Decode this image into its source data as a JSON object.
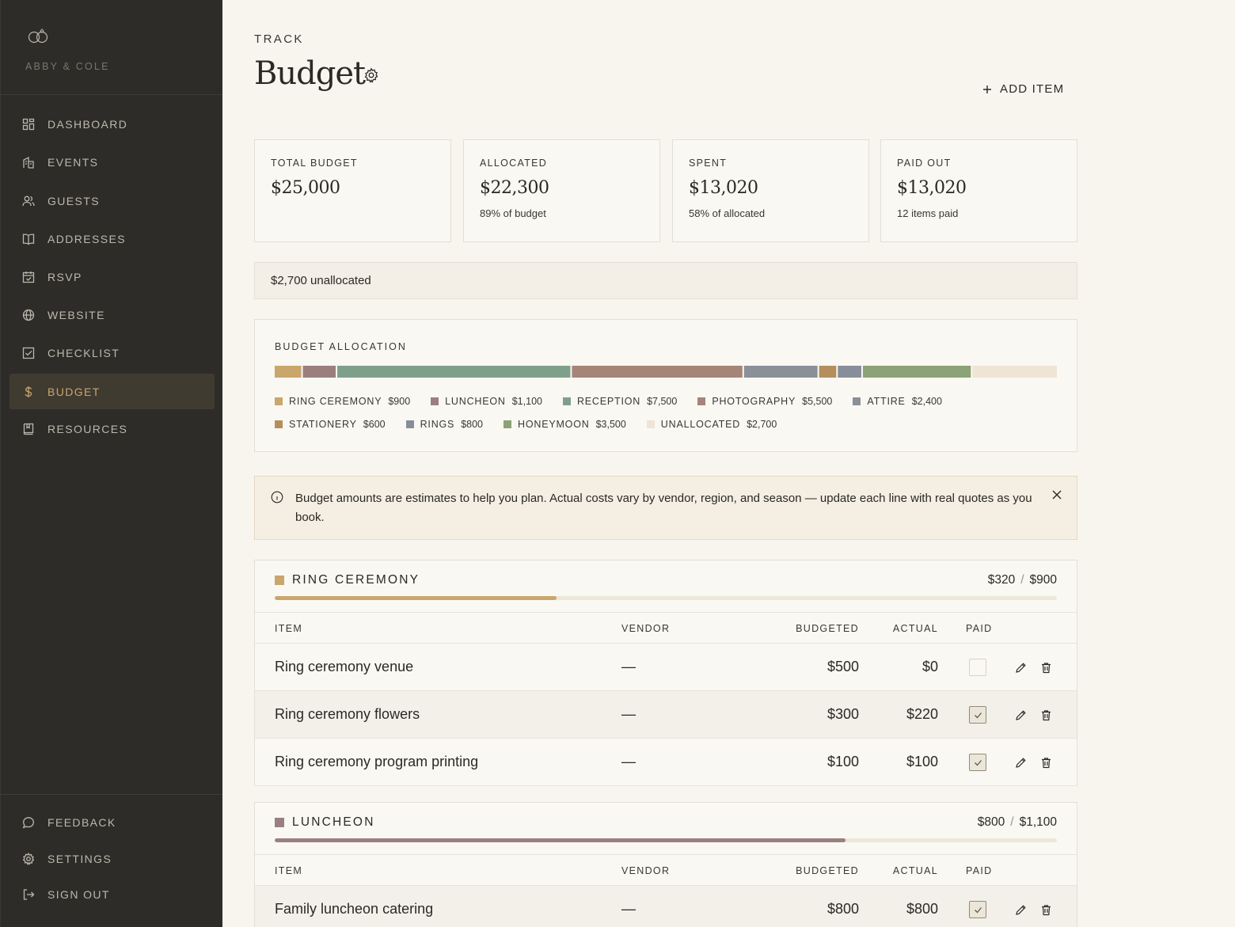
{
  "app": {
    "couple_name": "ABBY & COLE"
  },
  "sidebar": {
    "items": [
      {
        "label": "DASHBOARD",
        "icon": "dashboard-icon"
      },
      {
        "label": "EVENTS",
        "icon": "building-icon"
      },
      {
        "label": "GUESTS",
        "icon": "users-icon"
      },
      {
        "label": "ADDRESSES",
        "icon": "book-icon"
      },
      {
        "label": "RSVP",
        "icon": "calendar-check-icon"
      },
      {
        "label": "WEBSITE",
        "icon": "globe-icon"
      },
      {
        "label": "CHECKLIST",
        "icon": "checkbox-icon"
      },
      {
        "label": "BUDGET",
        "icon": "dollar-icon",
        "active": true
      },
      {
        "label": "RESOURCES",
        "icon": "bookmark-book-icon"
      }
    ],
    "footer": [
      {
        "label": "FEEDBACK",
        "icon": "chat-bubble-icon"
      },
      {
        "label": "SETTINGS",
        "icon": "gear-icon"
      },
      {
        "label": "SIGN OUT",
        "icon": "sign-out-icon"
      }
    ]
  },
  "header": {
    "eyebrow": "TRACK",
    "title": "Budget",
    "add_label": "ADD ITEM"
  },
  "summary": [
    {
      "label": "TOTAL BUDGET",
      "value": "$25,000",
      "sub": ""
    },
    {
      "label": "ALLOCATED",
      "value": "$22,300",
      "sub": "89% of budget"
    },
    {
      "label": "SPENT",
      "value": "$13,020",
      "sub": "58% of allocated"
    },
    {
      "label": "PAID OUT",
      "value": "$13,020",
      "sub": "12 items paid"
    }
  ],
  "unallocated_text": "$2,700 unallocated",
  "allocation": {
    "label": "BUDGET ALLOCATION",
    "total": 25000,
    "segments": [
      {
        "name": "RING CEREMONY",
        "amount": "$900",
        "value": 900,
        "color": "#c9a66b"
      },
      {
        "name": "LUNCHEON",
        "amount": "$1,100",
        "value": 1100,
        "color": "#9b7f7f"
      },
      {
        "name": "RECEPTION",
        "amount": "$7,500",
        "value": 7500,
        "color": "#7ea08a"
      },
      {
        "name": "PHOTOGRAPHY",
        "amount": "$5,500",
        "value": 5500,
        "color": "#a68478"
      },
      {
        "name": "ATTIRE",
        "amount": "$2,400",
        "value": 2400,
        "color": "#8a8f98"
      },
      {
        "name": "STATIONERY",
        "amount": "$600",
        "value": 600,
        "color": "#b48f5c"
      },
      {
        "name": "RINGS",
        "amount": "$800",
        "value": 800,
        "color": "#888d9b"
      },
      {
        "name": "HONEYMOON",
        "amount": "$3,500",
        "value": 3500,
        "color": "#8ca277"
      },
      {
        "name": "UNALLOCATED",
        "amount": "$2,700",
        "value": 2700,
        "color": "#efe5d6"
      }
    ]
  },
  "notice": {
    "text": "Budget amounts are estimates to help you plan. Actual costs vary by vendor, region, and season — update each line with real quotes as you book."
  },
  "table_headers": {
    "item": "ITEM",
    "vendor": "VENDOR",
    "budgeted": "BUDGETED",
    "actual": "ACTUAL",
    "paid": "PAID"
  },
  "categories": [
    {
      "name": "RING CEREMONY",
      "color": "#c9a66b",
      "spent": "$320",
      "budget": "$900",
      "progress": 0.36,
      "items": [
        {
          "item": "Ring ceremony venue",
          "vendor": "—",
          "budgeted": "$500",
          "actual": "$0",
          "paid": false
        },
        {
          "item": "Ring ceremony flowers",
          "vendor": "—",
          "budgeted": "$300",
          "actual": "$220",
          "paid": true
        },
        {
          "item": "Ring ceremony program printing",
          "vendor": "—",
          "budgeted": "$100",
          "actual": "$100",
          "paid": true
        }
      ]
    },
    {
      "name": "LUNCHEON",
      "color": "#9b7f7f",
      "spent": "$800",
      "budget": "$1,100",
      "progress": 0.73,
      "items": [
        {
          "item": "Family luncheon catering",
          "vendor": "—",
          "budgeted": "$800",
          "actual": "$800",
          "paid": true
        }
      ]
    }
  ]
}
